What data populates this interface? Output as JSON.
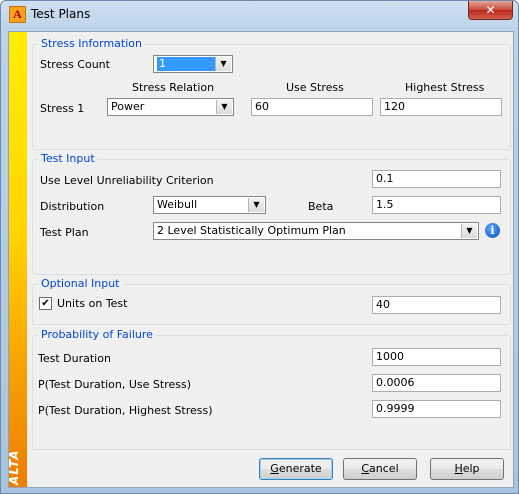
{
  "window": {
    "title": "Test Plans",
    "close_glyph": "✕",
    "brand": "ALTA"
  },
  "stress_info": {
    "title": "Stress Information",
    "count_label": "Stress Count",
    "count_value": "1",
    "col_relation": "Stress Relation",
    "col_use": "Use Stress",
    "col_highest": "Highest Stress",
    "row_label": "Stress 1",
    "relation_value": "Power",
    "use_value": "60",
    "highest_value": "120"
  },
  "test_input": {
    "title": "Test Input",
    "unrel_label": "Use Level Unreliability Criterion",
    "unrel_value": "0.1",
    "dist_label": "Distribution",
    "dist_value": "Weibull",
    "beta_label": "Beta",
    "beta_value": "1.5",
    "plan_label": "Test Plan",
    "plan_value": "2 Level Statistically Optimum Plan"
  },
  "optional": {
    "title": "Optional Input",
    "units_label": "Units on Test",
    "units_checked": true,
    "units_value": "40"
  },
  "pof": {
    "title": "Probability of Failure",
    "duration_label": "Test Duration",
    "duration_value": "1000",
    "use_label": "P(Test Duration, Use Stress)",
    "use_value": "0.0006",
    "high_label": "P(Test Duration, Highest Stress)",
    "high_value": "0.9999"
  },
  "buttons": {
    "generate_key": "G",
    "generate_rest": "enerate",
    "cancel_key": "C",
    "cancel_rest": "ancel",
    "help_key": "H",
    "help_rest": "elp"
  },
  "icons": {
    "dropdown": "▼",
    "check": "✔",
    "info": "i"
  }
}
